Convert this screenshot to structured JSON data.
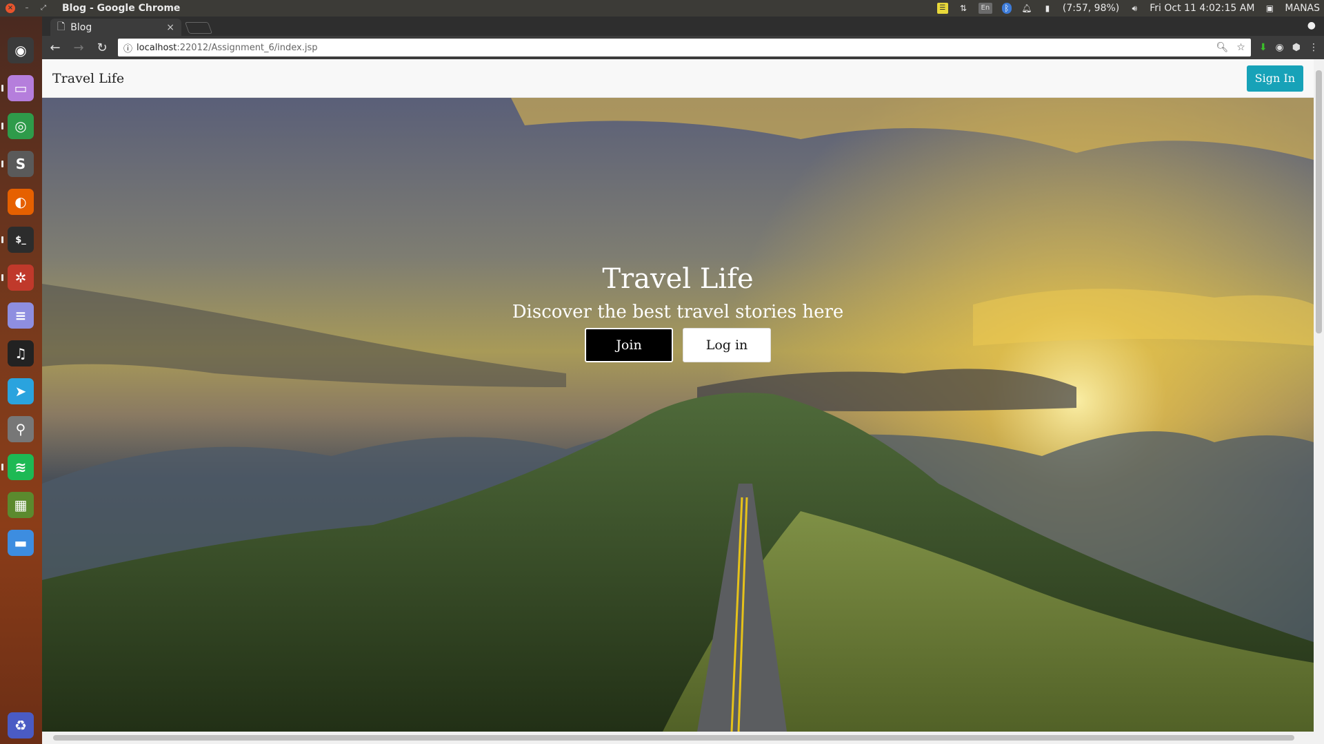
{
  "system": {
    "window_title": "Blog - Google Chrome",
    "battery": "(7:57, 98%)",
    "datetime": "Fri Oct 11  4:02:15 AM",
    "user": "MANAS",
    "keyboard_layout": "En"
  },
  "launcher": {
    "items": [
      {
        "name": "ubuntu-dash-icon",
        "glyph": "◉",
        "color": "#3a3a3a"
      },
      {
        "name": "files-icon",
        "glyph": "▭",
        "color": "#b57edc"
      },
      {
        "name": "chrome-icon",
        "glyph": "◎",
        "color": "#2e9b4a"
      },
      {
        "name": "sublime-text-icon",
        "glyph": "S",
        "color": "#5a5a5a"
      },
      {
        "name": "firefox-icon",
        "glyph": "◐",
        "color": "#e66000"
      },
      {
        "name": "terminal-icon",
        "glyph": "$_",
        "color": "#2c2c2c"
      },
      {
        "name": "app-center-icon",
        "glyph": "✲",
        "color": "#c0392b"
      },
      {
        "name": "text-editor-icon",
        "glyph": "≡",
        "color": "#8e8ee0"
      },
      {
        "name": "music-icon",
        "glyph": "♫",
        "color": "#222"
      },
      {
        "name": "telegram-icon",
        "glyph": "➤",
        "color": "#2aa3de"
      },
      {
        "name": "usb-icon",
        "glyph": "⚲",
        "color": "#777"
      },
      {
        "name": "spotify-icon",
        "glyph": "≋",
        "color": "#1db954"
      },
      {
        "name": "minecraft-icon",
        "glyph": "▦",
        "color": "#5b8a2e"
      },
      {
        "name": "folder-icon",
        "glyph": "▬",
        "color": "#3d8de0"
      }
    ],
    "trash": {
      "name": "trash-icon",
      "glyph": "♻",
      "color": "#4a5bc4"
    }
  },
  "browser": {
    "tab_title": "Blog",
    "url_host": "localhost",
    "url_path": ":22012/Assignment_6/index.jsp"
  },
  "page": {
    "brand": "Travel Life",
    "signin_label": "Sign In",
    "hero_title": "Travel Life",
    "hero_subtitle": "Discover the best travel stories here",
    "join_label": "Join",
    "login_label": "Log in",
    "accent_color": "#17a2b8"
  }
}
